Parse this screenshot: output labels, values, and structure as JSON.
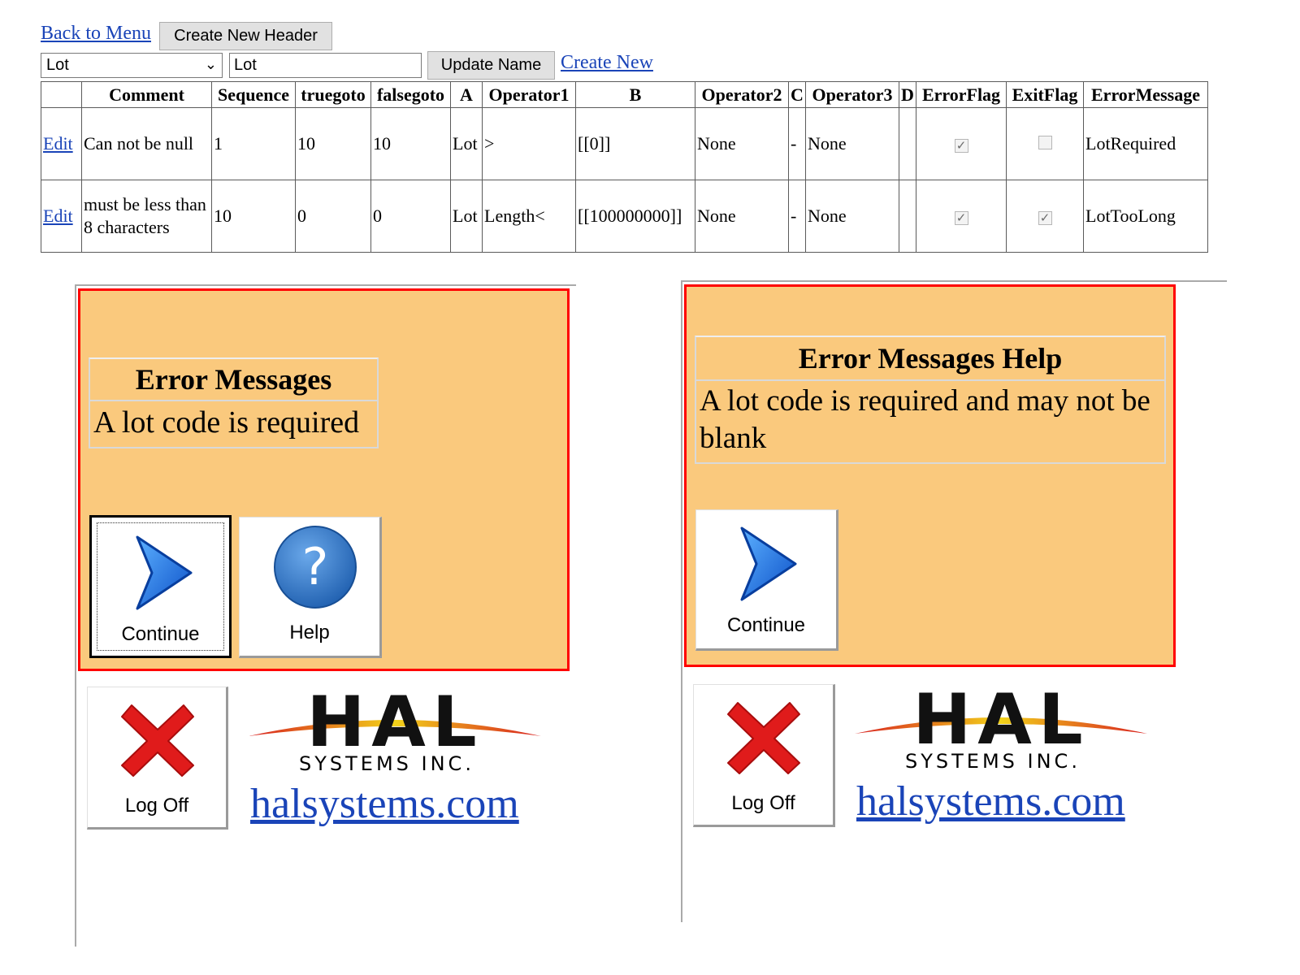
{
  "toolbar": {
    "back_link": "Back to Menu",
    "create_header_button": "Create New Header",
    "header_select_value": "Lot",
    "name_input_value": "Lot",
    "update_name_button": "Update Name",
    "create_new_link": "Create New"
  },
  "table": {
    "columns": [
      "Comment",
      "Sequence",
      "truegoto",
      "falsegoto",
      "A",
      "Operator1",
      "B",
      "Operator2",
      "C",
      "Operator3",
      "D",
      "ErrorFlag",
      "ExitFlag",
      "ErrorMessage"
    ],
    "edit_label": "Edit",
    "rows": [
      {
        "comment": "Can not be null",
        "sequence": "1",
        "truegoto": "10",
        "falsegoto": "10",
        "a": "Lot",
        "operator1": ">",
        "b": "[[0]]",
        "operator2": "None",
        "c": "-",
        "operator3": "None",
        "d": "",
        "error_flag": true,
        "exit_flag": false,
        "error_message": "LotRequired"
      },
      {
        "comment": "must be less than 8 characters",
        "sequence": "10",
        "truegoto": "0",
        "falsegoto": "0",
        "a": "Lot",
        "operator1": "Length<",
        "b": "[[100000000]]",
        "operator2": "None",
        "c": "-",
        "operator3": "None",
        "d": "",
        "error_flag": true,
        "exit_flag": true,
        "error_message": "LotTooLong"
      }
    ]
  },
  "left_panel": {
    "title": "Error Messages",
    "message": "A lot code is required",
    "continue_label": "Continue",
    "help_label": "Help",
    "logoff_label": "Log Off",
    "company_logo": "HAL",
    "company_tagline": "SYSTEMS INC.",
    "company_link": "halsystems.com"
  },
  "right_panel": {
    "title": "Error Messages Help",
    "message": "A lot code is required and may not be blank",
    "continue_label": "Continue",
    "logoff_label": "Log Off",
    "company_logo": "HAL",
    "company_tagline": "SYSTEMS INC.",
    "company_link": "halsystems.com"
  },
  "icons": {
    "continue": "chevron-right-icon",
    "help": "question-mark-icon",
    "logoff": "red-x-icon",
    "checkbox_checked": "✓"
  },
  "colors": {
    "panel_bg": "#fac97d",
    "panel_border": "#ff0000",
    "link": "#1a44b8",
    "continue_icon": "#1e6fe0",
    "help_icon": "#2a6fc4",
    "logoff_icon": "#e01b1b"
  }
}
